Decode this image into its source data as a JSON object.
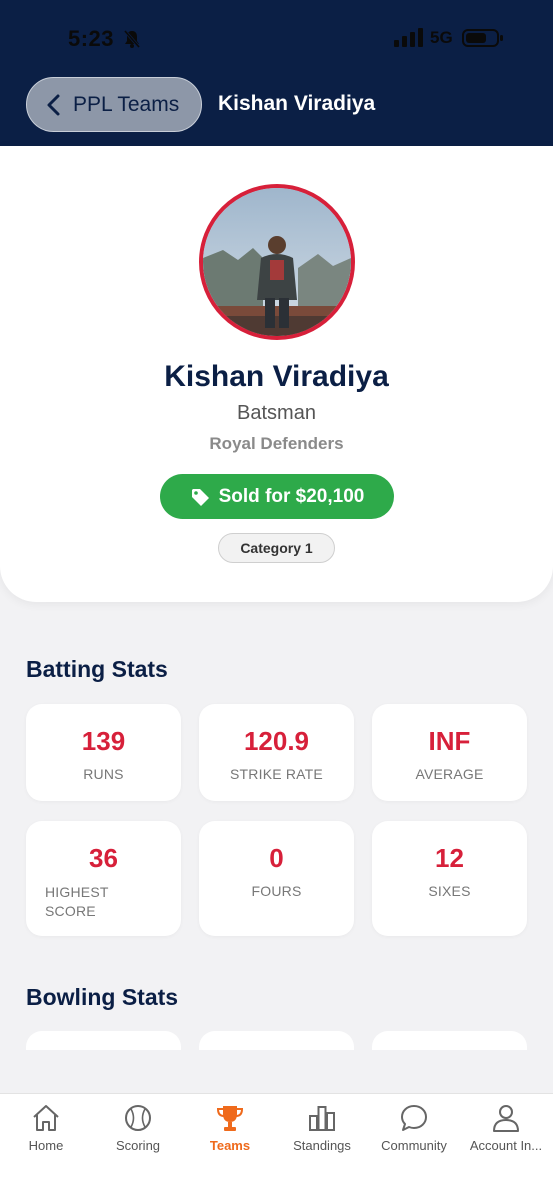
{
  "status_bar": {
    "time": "5:23",
    "network": "5G"
  },
  "header": {
    "back_label": "PPL Teams",
    "title": "Kishan Viradiya"
  },
  "profile": {
    "name": "Kishan Viradiya",
    "role": "Batsman",
    "team": "Royal Defenders",
    "sold_label": "Sold for $20,100",
    "category": "Category 1"
  },
  "batting": {
    "title": "Batting Stats",
    "stats": [
      {
        "value": "139",
        "label": "RUNS"
      },
      {
        "value": "120.9",
        "label": "STRIKE RATE"
      },
      {
        "value": "INF",
        "label": "AVERAGE"
      },
      {
        "value": "36",
        "label": "HIGHEST SCORE"
      },
      {
        "value": "0",
        "label": "FOURS"
      },
      {
        "value": "12",
        "label": "SIXES"
      }
    ]
  },
  "bowling": {
    "title": "Bowling Stats"
  },
  "tabs": [
    {
      "label": "Home",
      "icon": "home-icon"
    },
    {
      "label": "Scoring",
      "icon": "baseball-icon"
    },
    {
      "label": "Teams",
      "icon": "trophy-icon",
      "active": true
    },
    {
      "label": "Standings",
      "icon": "bar-chart-icon"
    },
    {
      "label": "Community",
      "icon": "chat-bubble-icon"
    },
    {
      "label": "Account In...",
      "icon": "person-icon"
    }
  ],
  "colors": {
    "navy": "#0b1f45",
    "accent_red": "#d7203a",
    "sold_green": "#2eaa4a",
    "active_tab": "#ef6a1c"
  }
}
